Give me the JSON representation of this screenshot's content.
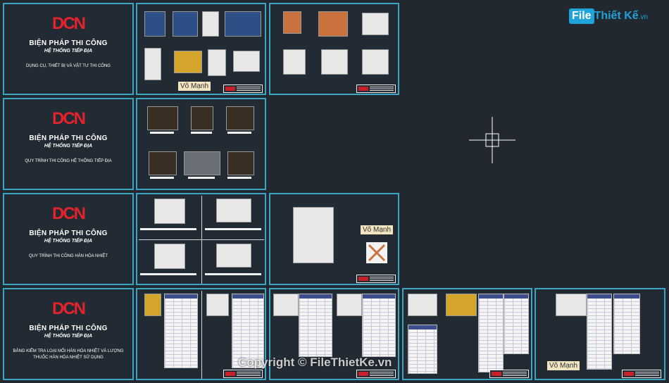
{
  "brand": {
    "box": "File",
    "text": "Thiết Kế",
    "suffix": ".vn"
  },
  "watermark": "Copyright © FileThietKe.vn",
  "logo": "DCN",
  "sheets": [
    {
      "title": "BIỆN PHÁP THI CÔNG",
      "subtitle": "HỆ THỐNG TIẾP ĐỊA",
      "desc": "DỤNG CỤ, THIẾT BỊ VÀ VẬT TƯ THI CÔNG"
    },
    {
      "title": "BIỆN PHÁP THI CÔNG",
      "subtitle": "HỆ THỐNG TIẾP ĐỊA",
      "desc": "QUY TRÌNH THI CÔNG HỆ THỐNG TIẾP ĐỊA"
    },
    {
      "title": "BIỆN PHÁP THI CÔNG",
      "subtitle": "HỆ THỐNG TIẾP ĐỊA",
      "desc": "QUY TRÌNH THI CÔNG HÀN HÓA NHIỆT"
    },
    {
      "title": "BIỆN PHÁP THI CÔNG",
      "subtitle": "HỆ THỐNG TIẾP ĐỊA",
      "desc": "BẢNG KIỂM TRA LOẠI MỐI HÀN HÓA NHIỆT VÀ LƯỢNG THUỐC HÀN HÓA NHIỆT SỬ DỤNG"
    }
  ],
  "tags": {
    "vo_manh": "Võ Mạnh"
  },
  "stamp_logo": "DCN",
  "icons": {
    "crosshair": "crosshair-icon"
  }
}
